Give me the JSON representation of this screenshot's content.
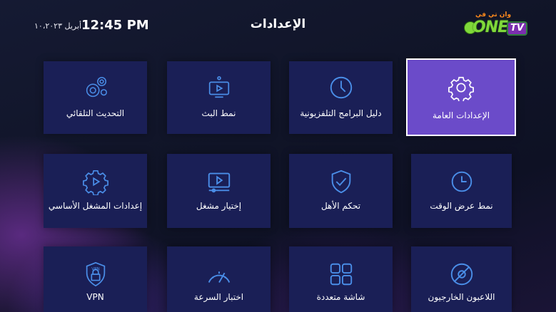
{
  "header": {
    "date": "أبريل ١٠،٢٠٢٣",
    "time": "12:45 PM",
    "title": "الإعدادات",
    "logo": {
      "arabic_text": "وان تي في",
      "brand_text": "ONE",
      "tv_text": "TV"
    }
  },
  "colors": {
    "tile": "#1a1f56",
    "tile_active": "#6b4bc9",
    "icon": "#4a8ee8"
  },
  "tiles": [
    {
      "label": "الإعدادات العامة",
      "icon": "gear-icon",
      "active": true
    },
    {
      "label": "دليل البرامج التلفزيونية",
      "icon": "clock-icon",
      "active": false
    },
    {
      "label": "نمط البث",
      "icon": "stream-icon",
      "active": false
    },
    {
      "label": "التحديث التلقائي",
      "icon": "gears-update-icon",
      "active": false
    },
    {
      "label": "نمط عرض الوقت",
      "icon": "time-format-icon",
      "active": false
    },
    {
      "label": "تحكم الأهل",
      "icon": "shield-check-icon",
      "active": false
    },
    {
      "label": "إختيار مشغل",
      "icon": "player-select-icon",
      "active": false
    },
    {
      "label": "إعدادات المشغل الأساسي",
      "icon": "player-settings-icon",
      "active": false
    },
    {
      "label": "اللاعبون الخارجيون",
      "icon": "external-player-icon",
      "active": false
    },
    {
      "label": "شاشة متعددة",
      "icon": "multiscreen-icon",
      "active": false
    },
    {
      "label": "اختبار السرعة",
      "icon": "speedometer-icon",
      "active": false
    },
    {
      "label": "VPN",
      "icon": "vpn-lock-icon",
      "active": false
    }
  ]
}
